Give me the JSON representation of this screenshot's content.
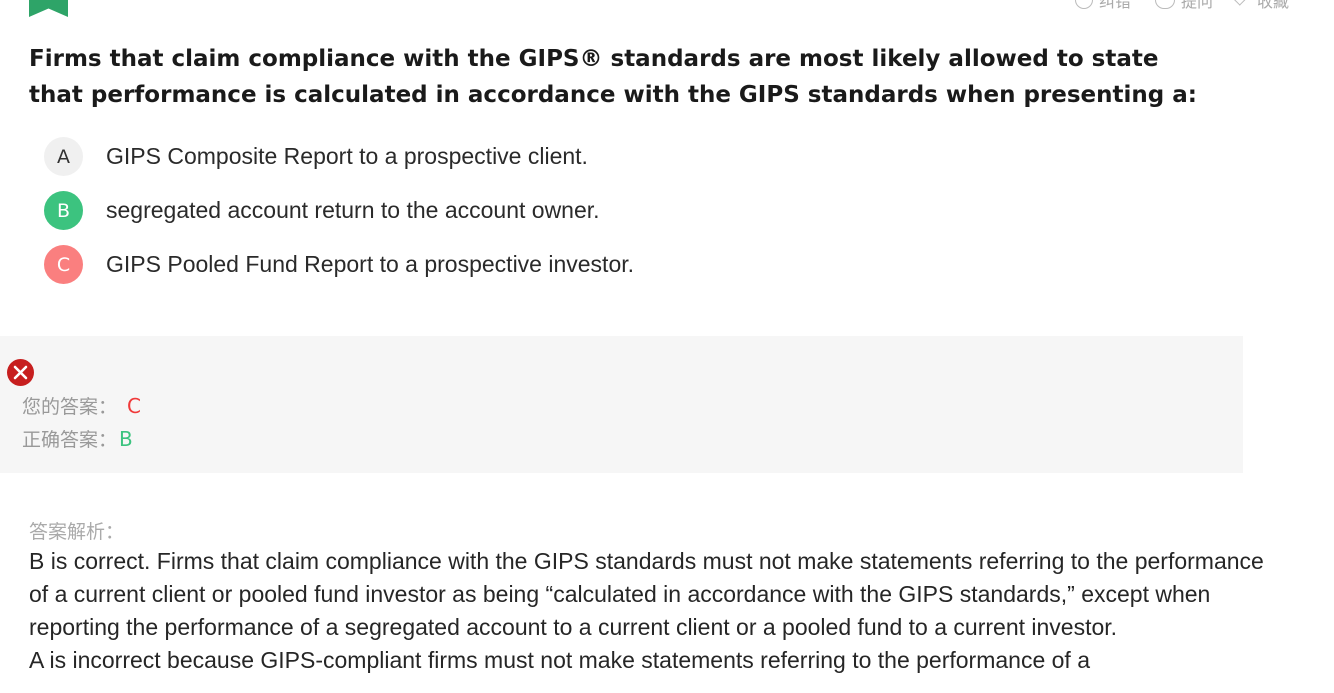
{
  "header": {
    "actions": [
      {
        "icon": "error-report-icon",
        "label": "纠错"
      },
      {
        "icon": "question-chat-icon",
        "label": "提问"
      },
      {
        "icon": "favorite-check-icon",
        "label": "收藏"
      }
    ],
    "bookmark_color": "#2ea468"
  },
  "question": {
    "text": "Firms that claim compliance with the GIPS® standards are most likely allowed to state that performance is calculated in accordance with the GIPS standards when presenting a:",
    "options": [
      {
        "letter": "A",
        "text": "GIPS Composite Report to a prospective client.",
        "state": "neutral"
      },
      {
        "letter": "B",
        "text": "segregated account return to the account owner.",
        "state": "correct"
      },
      {
        "letter": "C",
        "text": "GIPS Pooled Fund Report to a prospective investor.",
        "state": "wrong"
      }
    ]
  },
  "result": {
    "status_icon": "wrong-x-icon",
    "your_answer_label": "您的答案：",
    "your_answer": "C",
    "correct_answer_label": "正确答案：",
    "correct_answer": "B"
  },
  "explanation": {
    "label": "答案解析：",
    "paragraphs": [
      "B is correct. Firms that claim compliance with the GIPS standards must not make statements referring to the performance of a current client or pooled fund investor as being  “calculated in accordance with the GIPS standards,”  except when reporting the performance of a segregated account to a current client or a pooled fund to a current investor.",
      "A is incorrect because GIPS-compliant firms must not make statements referring to the performance of a"
    ]
  },
  "colors": {
    "correct": "#3cc37f",
    "wrong": "#fa7f7f",
    "wrong_text": "#f03a3a",
    "error_icon": "#c71f1f"
  }
}
